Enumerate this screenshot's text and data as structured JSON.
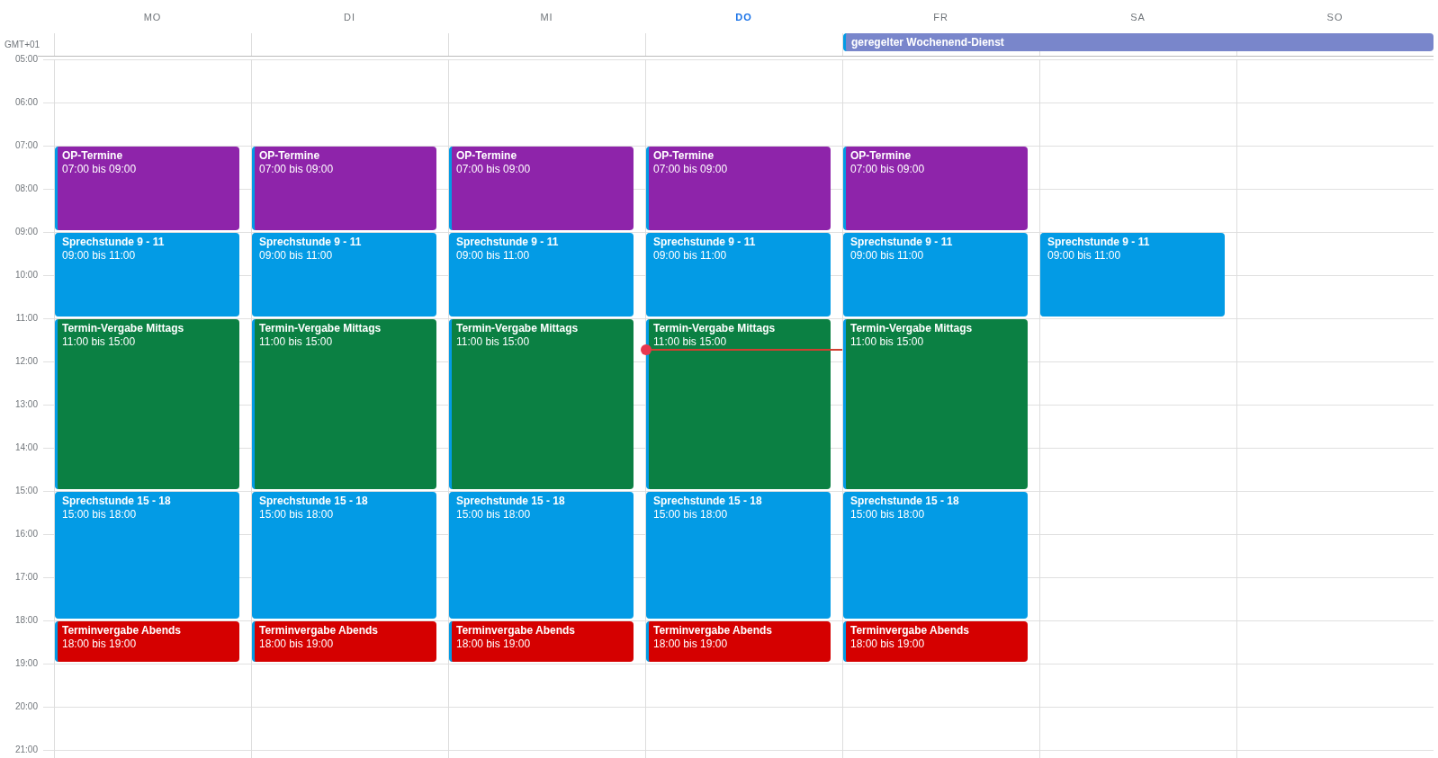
{
  "timezone": "GMT+01",
  "hours": [
    "05:00",
    "06:00",
    "07:00",
    "08:00",
    "09:00",
    "10:00",
    "11:00",
    "12:00",
    "13:00",
    "14:00",
    "15:00",
    "16:00",
    "17:00",
    "18:00",
    "19:00",
    "20:00",
    "21:00"
  ],
  "days": [
    {
      "label": "MO",
      "today": false,
      "events": [
        {
          "title": "OP-Termine",
          "time": "07:00 bis 09:00",
          "color": "#8e24aa"
        },
        {
          "title": "Sprechstunde 9 - 11",
          "time": "09:00 bis 11:00",
          "color": "#039be5"
        },
        {
          "title": "Termin-Vergabe Mittags",
          "time": "11:00 bis 15:00",
          "color": "#0b8043"
        },
        {
          "title": "Sprechstunde 15 - 18",
          "time": "15:00 bis 18:00",
          "color": "#039be5"
        },
        {
          "title": "Terminvergabe Abends",
          "time": "18:00 bis 19:00",
          "color": "#d50000"
        }
      ]
    },
    {
      "label": "DI",
      "today": false,
      "events": [
        {
          "title": "OP-Termine",
          "time": "07:00 bis 09:00",
          "color": "#8e24aa"
        },
        {
          "title": "Sprechstunde 9 - 11",
          "time": "09:00 bis 11:00",
          "color": "#039be5"
        },
        {
          "title": "Termin-Vergabe Mittags",
          "time": "11:00 bis 15:00",
          "color": "#0b8043"
        },
        {
          "title": "Sprechstunde 15 - 18",
          "time": "15:00 bis 18:00",
          "color": "#039be5"
        },
        {
          "title": "Terminvergabe Abends",
          "time": "18:00 bis 19:00",
          "color": "#d50000"
        }
      ]
    },
    {
      "label": "MI",
      "today": false,
      "events": [
        {
          "title": "OP-Termine",
          "time": "07:00 bis 09:00",
          "color": "#8e24aa"
        },
        {
          "title": "Sprechstunde 9 - 11",
          "time": "09:00 bis 11:00",
          "color": "#039be5"
        },
        {
          "title": "Termin-Vergabe Mittags",
          "time": "11:00 bis 15:00",
          "color": "#0b8043"
        },
        {
          "title": "Sprechstunde 15 - 18",
          "time": "15:00 bis 18:00",
          "color": "#039be5"
        },
        {
          "title": "Terminvergabe Abends",
          "time": "18:00 bis 19:00",
          "color": "#d50000"
        }
      ]
    },
    {
      "label": "DO",
      "today": true,
      "events": [
        {
          "title": "OP-Termine",
          "time": "07:00 bis 09:00",
          "color": "#8e24aa"
        },
        {
          "title": "Sprechstunde 9 - 11",
          "time": "09:00 bis 11:00",
          "color": "#039be5"
        },
        {
          "title": "Termin-Vergabe Mittags",
          "time": "11:00 bis 15:00",
          "color": "#0b8043"
        },
        {
          "title": "Sprechstunde 15 - 18",
          "time": "15:00 bis 18:00",
          "color": "#039be5"
        },
        {
          "title": "Terminvergabe Abends",
          "time": "18:00 bis 19:00",
          "color": "#d50000"
        }
      ]
    },
    {
      "label": "FR",
      "today": false,
      "all_day": {
        "title": "geregelter Wochenend-Dienst",
        "color": "#7986cb"
      },
      "events": [
        {
          "title": "OP-Termine",
          "time": "07:00 bis 09:00",
          "color": "#8e24aa"
        },
        {
          "title": "Sprechstunde 9 - 11",
          "time": "09:00 bis 11:00",
          "color": "#039be5"
        },
        {
          "title": "Termin-Vergabe Mittags",
          "time": "11:00 bis 15:00",
          "color": "#0b8043"
        },
        {
          "title": "Sprechstunde 15 - 18",
          "time": "15:00 bis 18:00",
          "color": "#039be5"
        },
        {
          "title": "Terminvergabe Abends",
          "time": "18:00 bis 19:00",
          "color": "#d50000"
        }
      ]
    },
    {
      "label": "SA",
      "today": false,
      "events": [
        {
          "title": "Sprechstunde 9 - 11",
          "time": "09:00 bis 11:00",
          "color": "#039be5"
        }
      ]
    },
    {
      "label": "SO",
      "today": false
    }
  ]
}
